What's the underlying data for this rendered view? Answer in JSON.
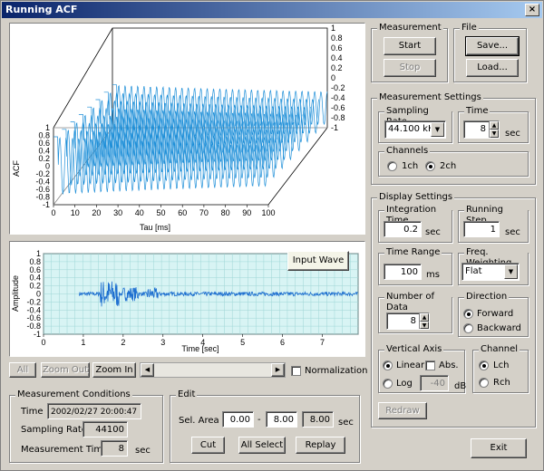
{
  "window": {
    "title": "Running ACF",
    "close_glyph": "×"
  },
  "acf_plot": {
    "zlabel": "ACF",
    "xlabel": "Tau [ms]",
    "x_ticks": [
      "0",
      "10",
      "20",
      "30",
      "40",
      "50",
      "60",
      "70",
      "80",
      "90",
      "100"
    ],
    "z_ticks_left": [
      "1",
      "0.8",
      "0.6",
      "0.4",
      "0.2",
      "0",
      "-0.2",
      "-0.4",
      "-0.6",
      "-0.8",
      "-1"
    ],
    "z_ticks_right": [
      "1",
      "0.8",
      "0.6",
      "0.4",
      "0.2",
      "0",
      "-0.2",
      "-0.4",
      "-0.6",
      "-0.8",
      "-1"
    ],
    "line_color": "#1e8fd8"
  },
  "wave_plot": {
    "ylabel": "Amplitude",
    "xlabel": "Time [sec]",
    "x_ticks": [
      "0",
      "1",
      "2",
      "3",
      "4",
      "5",
      "6",
      "7"
    ],
    "y_ticks": [
      "1",
      "0.8",
      "0.6",
      "0.4",
      "0.2",
      "0",
      "-0.2",
      "-0.4",
      "-0.6",
      "-0.8",
      "-1"
    ],
    "legend_label": "Input Wave",
    "bg_color": "#d8f4f4",
    "line_color": "#1e6fd0"
  },
  "toolbar": {
    "all": "All",
    "zoom_out": "Zoom Out",
    "zoom_in": "Zoom In",
    "normalization": "Normalization",
    "left_arrow": "◀",
    "right_arrow": "▶"
  },
  "measurement": {
    "title": "Measurement",
    "start": "Start",
    "stop": "Stop"
  },
  "file": {
    "title": "File",
    "save": "Save...",
    "load": "Load..."
  },
  "measurement_settings": {
    "title": "Measurement Settings",
    "sampling_rate_title": "Sampling Rate",
    "sampling_rate_value": "44.100 kHz",
    "time_title": "Time",
    "time_value": "8",
    "time_unit": "sec",
    "channels_title": "Channels",
    "ch1": "1ch",
    "ch2": "2ch"
  },
  "display_settings": {
    "title": "Display Settings",
    "integration_time_title": "Integration Time",
    "integration_time_value": "0.2",
    "integration_time_unit": "sec",
    "running_step_title": "Running Step",
    "running_step_value": "1",
    "running_step_unit": "sec",
    "time_range_title": "Time Range",
    "time_range_value": "100",
    "time_range_unit": "ms",
    "freq_weighting_title": "Freq. Weighting",
    "freq_weighting_value": "Flat",
    "number_of_data_title": "Number of Data",
    "number_of_data_value": "8",
    "direction_title": "Direction",
    "forward": "Forward",
    "backward": "Backward",
    "vertical_axis_title": "Vertical Axis",
    "linear": "Linear",
    "abs": "Abs.",
    "log": "Log",
    "log_value": "-40",
    "log_unit": "dB",
    "channel_title": "Channel",
    "lch": "Lch",
    "rch": "Rch",
    "redraw": "Redraw"
  },
  "measurement_conditions": {
    "title": "Measurement Conditions",
    "time_label": "Time",
    "time_value": "2002/02/27 20:00:47",
    "sampling_rate_label": "Sampling Rate",
    "sampling_rate_value": "44100",
    "measurement_time_label": "Measurement Time",
    "measurement_time_value": "8",
    "measurement_time_unit": "sec"
  },
  "edit": {
    "title": "Edit",
    "sel_area_label": "Sel. Area",
    "sel_start": "0.00",
    "dash": "-",
    "sel_end": "8.00",
    "sel_len": "8.00",
    "unit": "sec",
    "cut": "Cut",
    "all_select": "All Select",
    "replay": "Replay"
  },
  "exit": "Exit"
}
